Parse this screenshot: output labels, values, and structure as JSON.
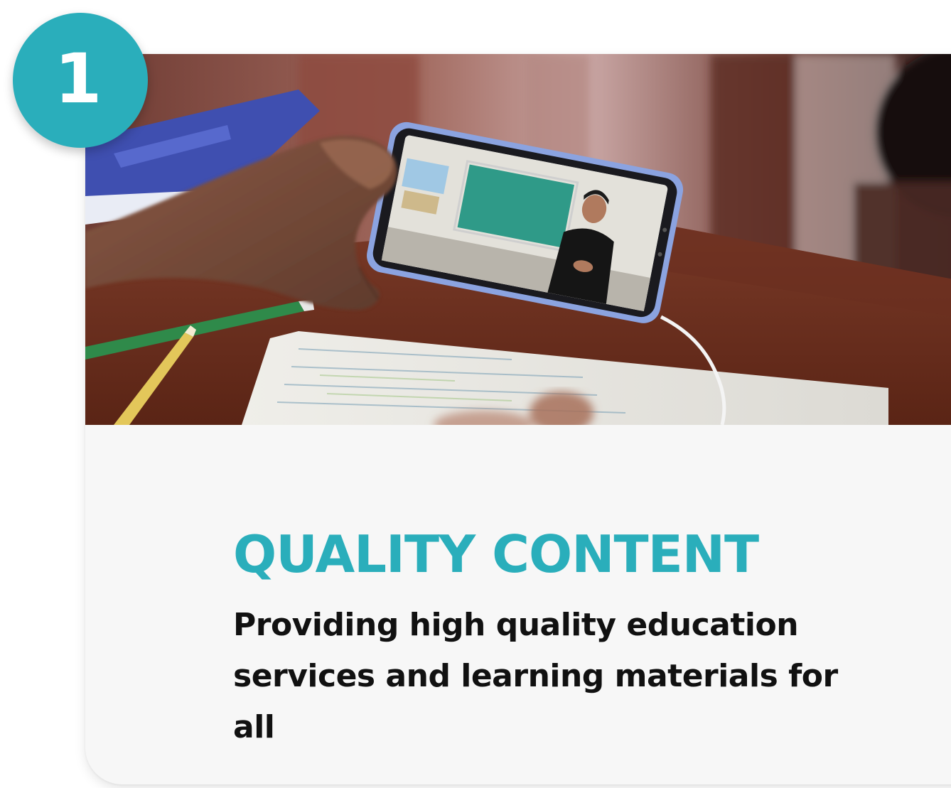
{
  "step": {
    "number": "1"
  },
  "feature": {
    "title": "QUALITY CONTENT",
    "description": "Providing high quality education services and learning materials for all"
  },
  "photo": {
    "subject": "hand-holding-smartphone-showing-video-lesson"
  },
  "colors": {
    "accent": "#2aaebb",
    "card_background": "#f7f7f7",
    "text": "#111111"
  }
}
